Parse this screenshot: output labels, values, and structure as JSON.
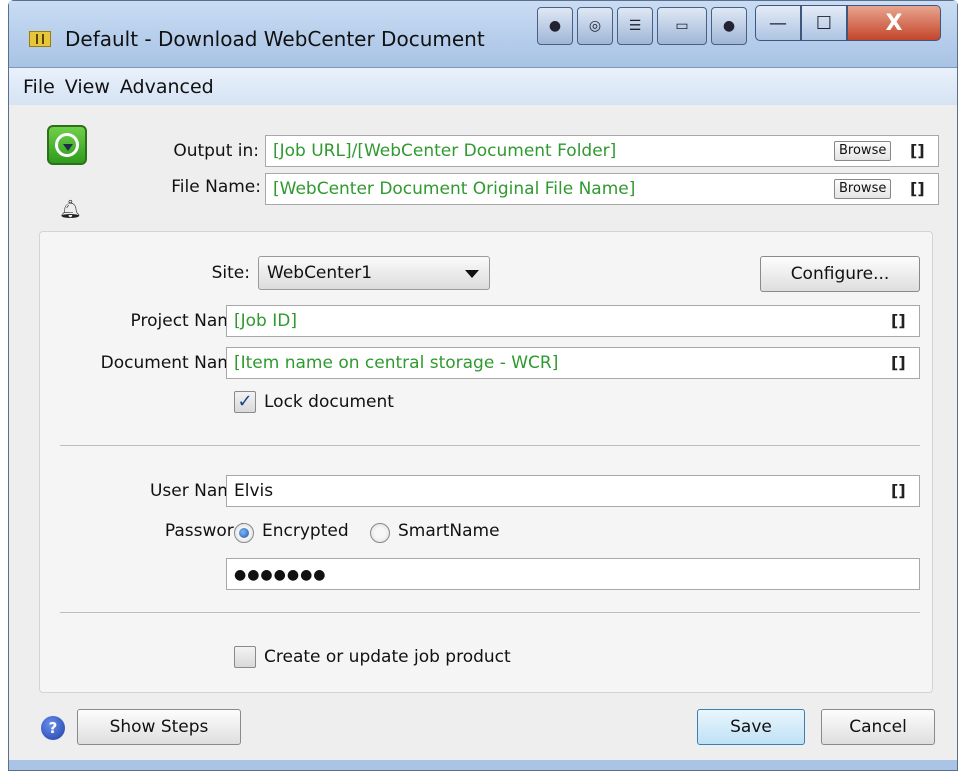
{
  "window": {
    "title": "Default - Download WebCenter Document",
    "toolbar_icons": [
      "view-icon-1",
      "view-icon-2",
      "view-icon-3",
      "view-icon-4",
      "view-icon-5"
    ],
    "controls": {
      "minimize": "—",
      "maximize": "☐",
      "close": "X"
    }
  },
  "menu": [
    "File",
    "View",
    "Advanced"
  ],
  "output": {
    "output_in_label": "Output in:",
    "output_in_value": "[Job URL]/[WebCenter Document Folder]",
    "file_name_label": "File Name:",
    "file_name_value": "[WebCenter Document Original File Name]",
    "browse_label": "Browse",
    "smartname_glyph": "[]"
  },
  "form": {
    "site_label": "Site:",
    "site_value": "WebCenter1",
    "configure_label": "Configure...",
    "project_label": "Project Name:",
    "project_value": "[Job ID]",
    "document_label": "Document Name:",
    "document_value": "[Item name on central storage - WCR]",
    "lock_label": "Lock document",
    "lock_checked": true,
    "user_label": "User Name:",
    "user_value": "Elvis",
    "password_label": "Password:",
    "password_mode_encrypted": "Encrypted",
    "password_mode_smartname": "SmartName",
    "password_mode_selected": "Encrypted",
    "password_value": "●●●●●●●",
    "create_product_label": "Create or update job product",
    "create_product_checked": false
  },
  "footer": {
    "help_glyph": "?",
    "show_steps_label": "Show Steps",
    "save_label": "Save",
    "cancel_label": "Cancel"
  },
  "colors": {
    "smartname_text": "#2f9a2f",
    "window_frame": "#a9c4e4"
  }
}
